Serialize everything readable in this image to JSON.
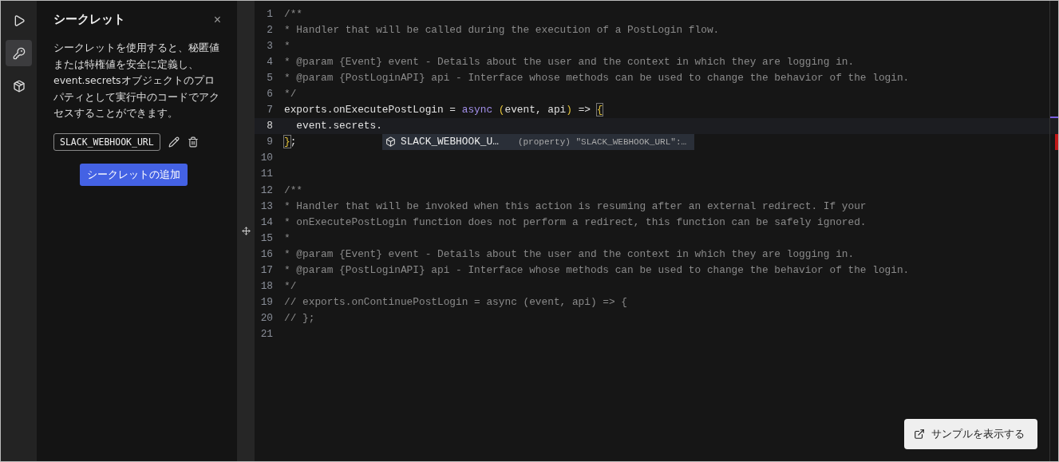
{
  "rail": [
    {
      "kind": "play",
      "selected": false
    },
    {
      "kind": "key",
      "selected": true
    },
    {
      "kind": "box",
      "selected": false
    }
  ],
  "panel": {
    "title": "シークレット",
    "close": "×",
    "description": "シークレットを使用すると、秘匿値または特権値を安全に定義し、event.secretsオブジェクトのプロパティとして実行中のコードでアクセスすることができます。",
    "secrets": [
      {
        "name": "SLACK_WEBHOOK_URL"
      }
    ],
    "add_button": "シークレットの追加"
  },
  "editor": {
    "lines": [
      {
        "number": "1",
        "current": false,
        "tokens": [
          {
            "text": "/**",
            "kind": "comment"
          }
        ]
      },
      {
        "number": "2",
        "current": false,
        "tokens": [
          {
            "text": "* Handler that will be called during the execution of a PostLogin flow.",
            "kind": "comment"
          }
        ]
      },
      {
        "number": "3",
        "current": false,
        "tokens": [
          {
            "text": "*",
            "kind": "comment"
          }
        ]
      },
      {
        "number": "4",
        "current": false,
        "tokens": [
          {
            "text": "* @param {Event} event - Details about the user and the context in which they are logging in.",
            "kind": "comment"
          }
        ]
      },
      {
        "number": "5",
        "current": false,
        "tokens": [
          {
            "text": "* @param {PostLoginAPI} api - Interface whose methods can be used to change the behavior of the login.",
            "kind": "comment"
          }
        ]
      },
      {
        "number": "6",
        "current": false,
        "tokens": [
          {
            "text": "*/",
            "kind": "comment"
          }
        ]
      },
      {
        "number": "7",
        "current": false,
        "tokens": [
          {
            "text": "exports.onExecutePostLogin = ",
            "kind": "plain"
          },
          {
            "text": "async",
            "kind": "keyword"
          },
          {
            "text": " (",
            "kind": "paren"
          },
          {
            "text": "event, api",
            "kind": "plain"
          },
          {
            "text": ")",
            "kind": "paren"
          },
          {
            "text": " => ",
            "kind": "plain"
          },
          {
            "text": "{",
            "kind": "match"
          }
        ]
      },
      {
        "number": "8",
        "current": true,
        "tokens": [
          {
            "text": "  event.secrets.",
            "kind": "plain"
          }
        ]
      },
      {
        "number": "9",
        "current": false,
        "tokens": [
          {
            "text": "}",
            "kind": "match"
          },
          {
            "text": ";",
            "kind": "plain"
          }
        ],
        "suggestion": {
          "label": "SLACK_WEBHOOK_U…",
          "detail": "(property) \"SLACK_WEBHOOK_URL\":…"
        }
      },
      {
        "number": "10",
        "current": false
      },
      {
        "number": "11",
        "current": false
      },
      {
        "number": "12",
        "current": false,
        "tokens": [
          {
            "text": "/**",
            "kind": "comment"
          }
        ]
      },
      {
        "number": "13",
        "current": false,
        "tokens": [
          {
            "text": "* Handler that will be invoked when this action is resuming after an external redirect. If your",
            "kind": "comment"
          }
        ]
      },
      {
        "number": "14",
        "current": false,
        "tokens": [
          {
            "text": "* onExecutePostLogin function does not perform a redirect, this function can be safely ignored.",
            "kind": "comment"
          }
        ]
      },
      {
        "number": "15",
        "current": false,
        "tokens": [
          {
            "text": "*",
            "kind": "comment"
          }
        ]
      },
      {
        "number": "16",
        "current": false,
        "tokens": [
          {
            "text": "* @param {Event} event - Details about the user and the context in which they are logging in.",
            "kind": "comment"
          }
        ]
      },
      {
        "number": "17",
        "current": false,
        "tokens": [
          {
            "text": "* @param {PostLoginAPI} api - Interface whose methods can be used to change the behavior of the login.",
            "kind": "comment"
          }
        ]
      },
      {
        "number": "18",
        "current": false,
        "tokens": [
          {
            "text": "*/",
            "kind": "comment"
          }
        ]
      },
      {
        "number": "19",
        "current": false,
        "tokens": [
          {
            "text": "// exports.onContinuePostLogin = async (event, api) => {",
            "kind": "comment"
          }
        ]
      },
      {
        "number": "20",
        "current": false,
        "tokens": [
          {
            "text": "// };",
            "kind": "comment"
          }
        ]
      },
      {
        "number": "21",
        "current": false
      }
    ]
  },
  "sample_button": "サンプルを表示する"
}
